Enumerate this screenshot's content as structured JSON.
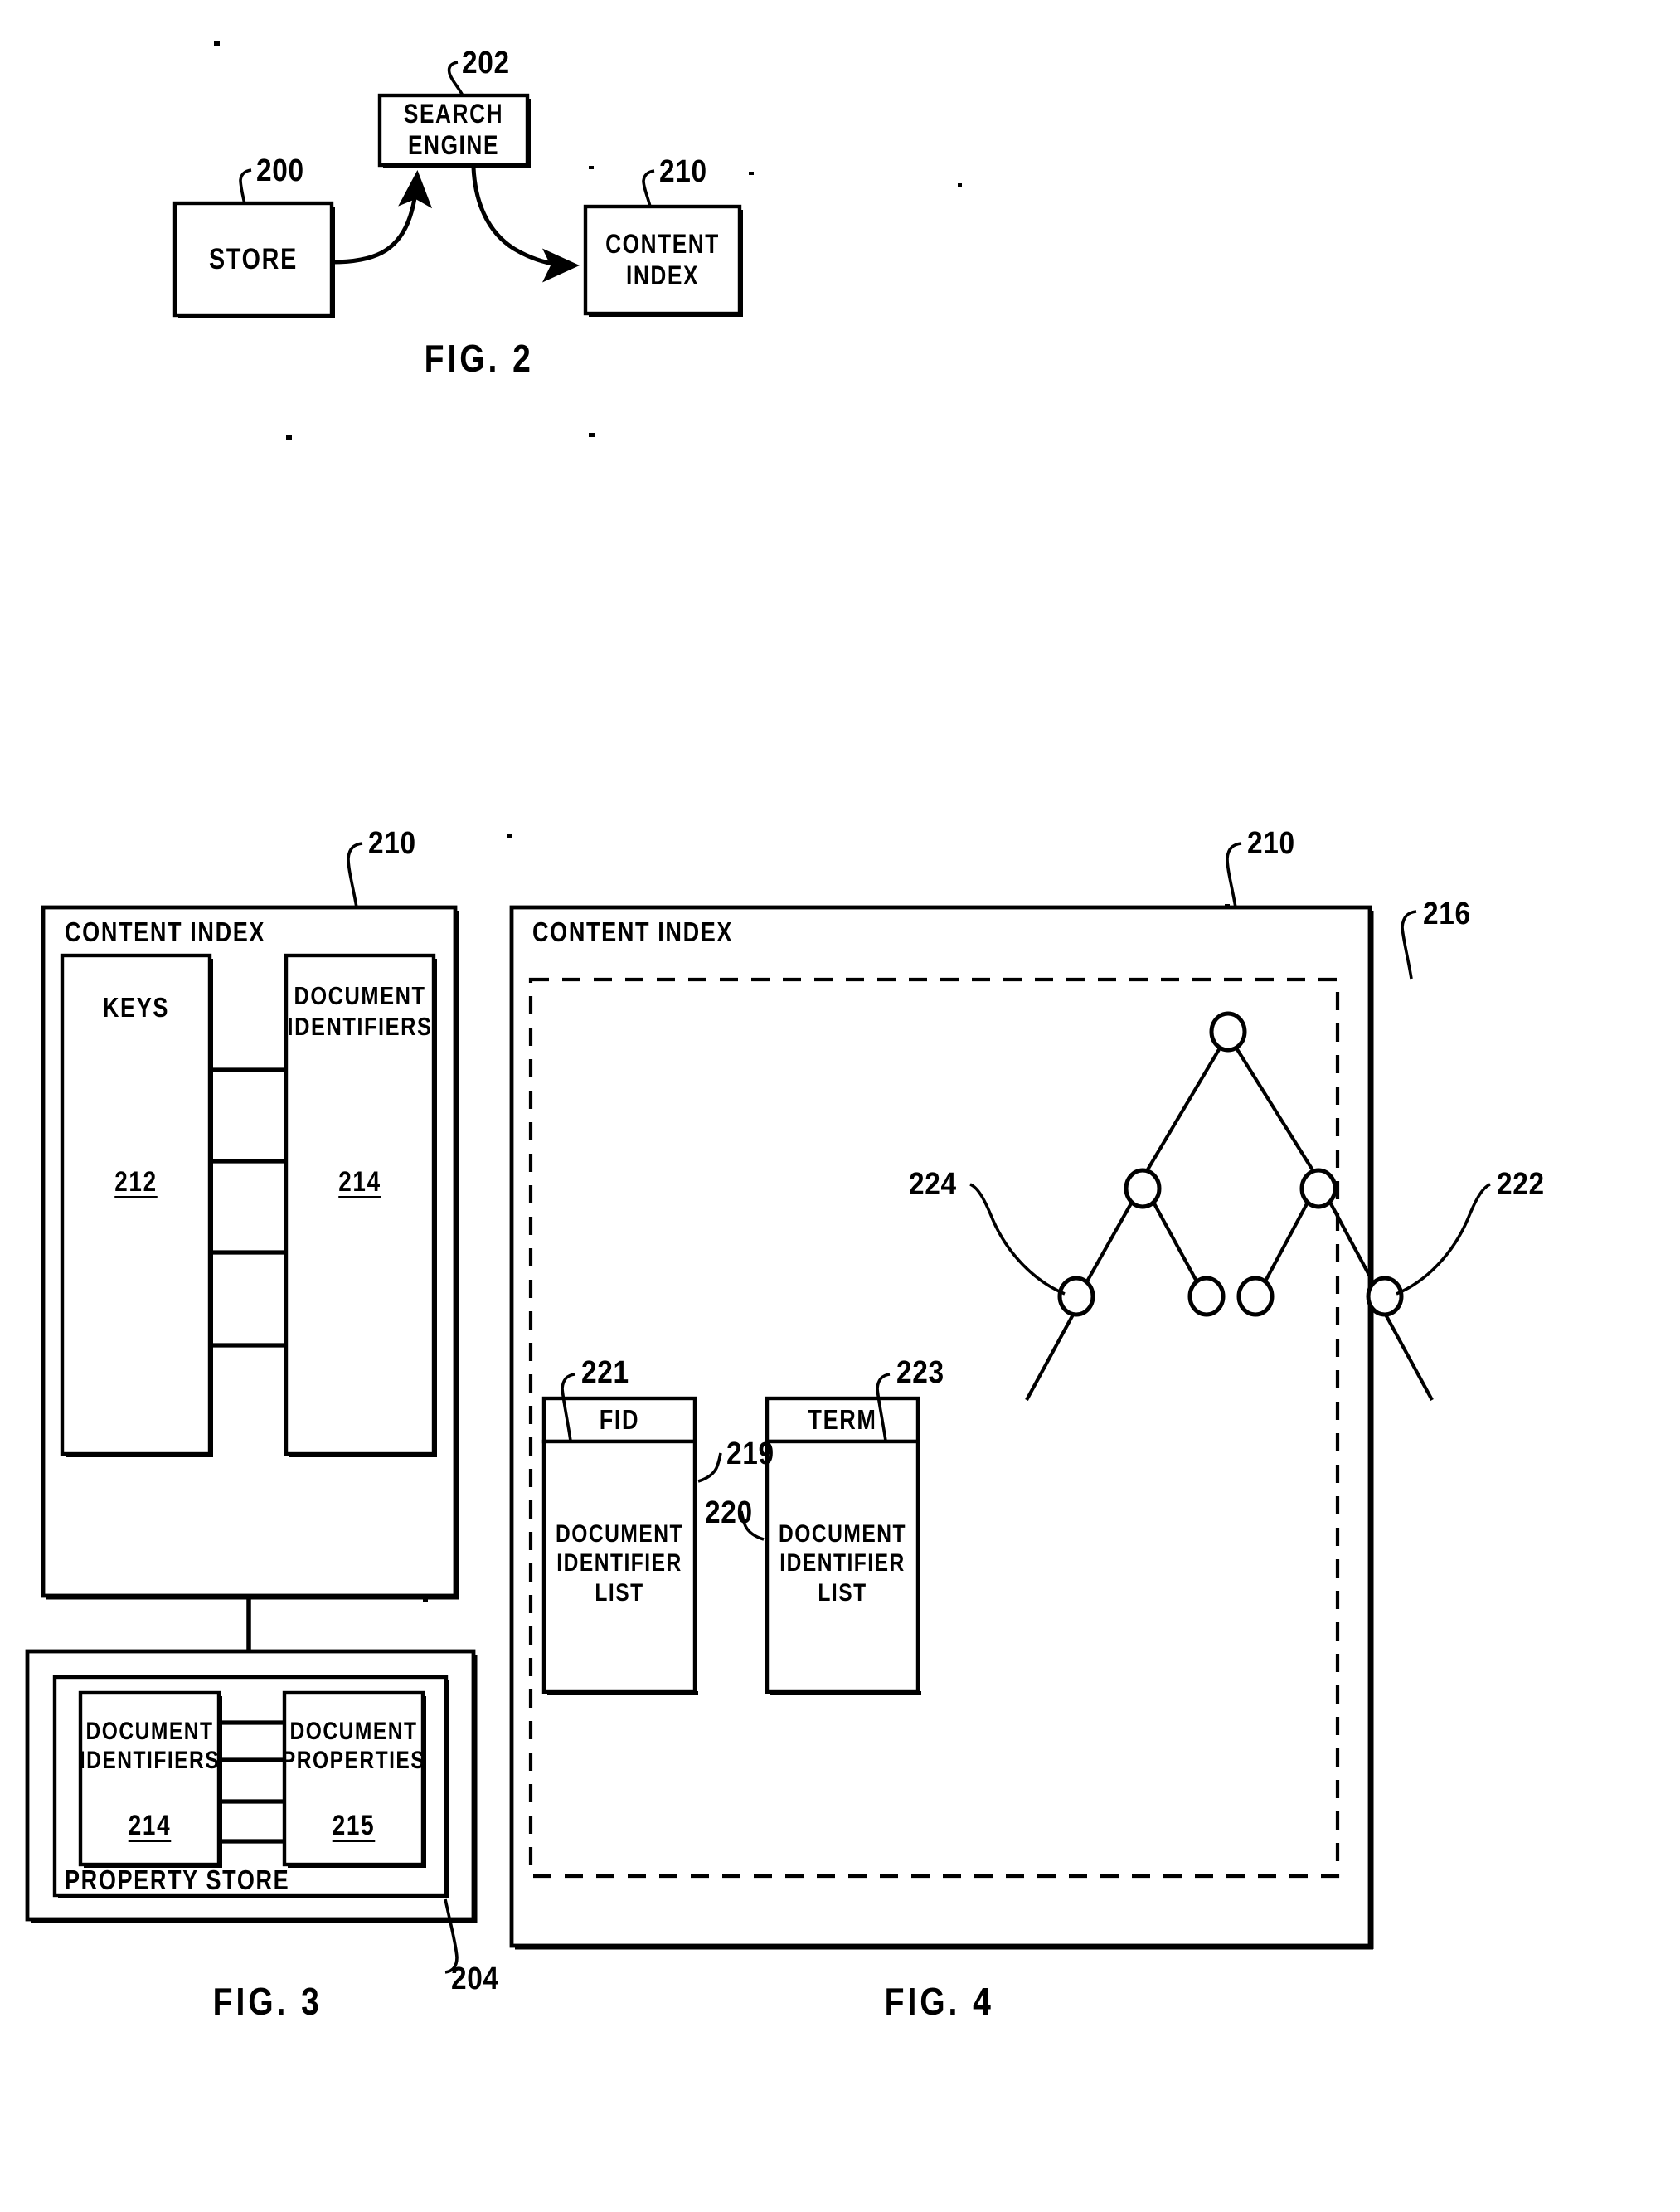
{
  "document": {
    "type": "patent-drawing-sheet",
    "figures": [
      "FIG. 2",
      "FIG. 3",
      "FIG. 4"
    ]
  },
  "fig2": {
    "caption": "FIG. 2",
    "boxes": {
      "store": {
        "label": "STORE",
        "ref": "200"
      },
      "search_engine": {
        "label": "SEARCH\nENGINE",
        "ref": "202"
      },
      "content_index": {
        "label": "CONTENT\nINDEX",
        "ref": "210"
      }
    },
    "arrows": [
      {
        "from": "store",
        "to": "search_engine"
      },
      {
        "from": "search_engine",
        "to": "content_index"
      }
    ]
  },
  "fig3": {
    "caption": "FIG. 3",
    "content_index": {
      "title": "CONTENT INDEX",
      "ref": "210",
      "keys": {
        "label": "KEYS",
        "ref": "212"
      },
      "document_identifiers": {
        "label": "DOCUMENT\nIDENTIFIERS",
        "ref": "214"
      },
      "connector_count": 4
    },
    "property_store": {
      "title": "PROPERTY STORE",
      "ref": "204",
      "document_identifiers": {
        "label": "DOCUMENT\nIDENTIFIERS",
        "ref": "214"
      },
      "document_properties": {
        "label": "DOCUMENT\nPROPERTIES",
        "ref": "215"
      },
      "connector_count": 4
    }
  },
  "fig4": {
    "caption": "FIG. 4",
    "content_index": {
      "title": "CONTENT INDEX",
      "ref": "210"
    },
    "dashed_region": {
      "ref": "216"
    },
    "tree": {
      "root_ref": null,
      "left_branch_ref": "224",
      "right_branch_ref": "222",
      "node_count": 7,
      "levels": 3
    },
    "fid_column": {
      "header": "FID",
      "header_ref": "221",
      "list_label": "DOCUMENT\nIDENTIFIER\nLIST",
      "list_ref": "219"
    },
    "term_column": {
      "header": "TERM",
      "header_ref": "223",
      "list_label": "DOCUMENT\nIDENTIFIER\nLIST",
      "list_ref": "220"
    }
  },
  "colors": {
    "ink": "#000000",
    "paper": "#ffffff"
  }
}
